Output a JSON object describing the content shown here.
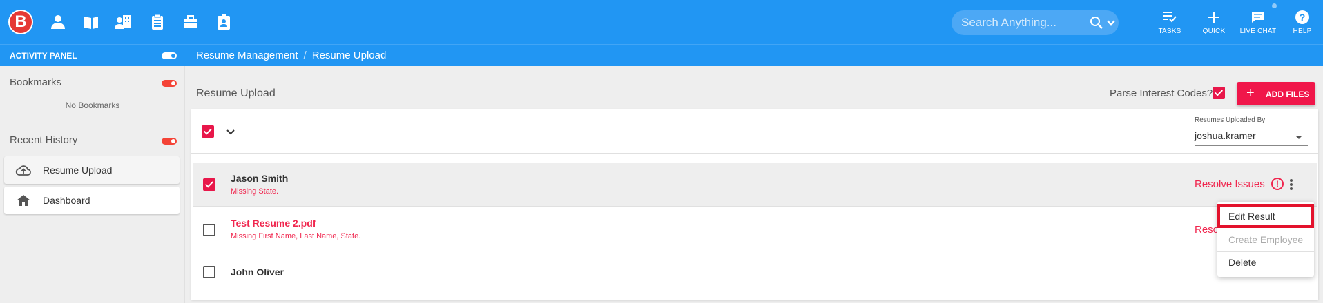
{
  "app": {
    "logo_letter": "B",
    "brand_color": "#2196f3",
    "accent_color": "#f0164a"
  },
  "nav_icons": [
    "person-icon",
    "book-icon",
    "people-group-icon",
    "clipboard-icon",
    "briefcase-icon",
    "badge-icon"
  ],
  "search": {
    "placeholder": "Search Anything..."
  },
  "top_actions": {
    "tasks": "TASKS",
    "quick": "QUICK",
    "live_chat": "LIVE CHAT",
    "help": "HELP"
  },
  "activity_panel": {
    "title": "ACTIVITY PANEL",
    "bookmarks_title": "Bookmarks",
    "no_bookmarks": "No Bookmarks",
    "recent_title": "Recent History",
    "recent_items": [
      {
        "label": "Resume Upload",
        "icon": "cloud-upload-icon"
      },
      {
        "label": "Dashboard",
        "icon": "home-icon"
      }
    ]
  },
  "breadcrumb": {
    "parent": "Resume Management",
    "separator": "/",
    "current": "Resume Upload"
  },
  "main": {
    "page_title": "Resume Upload",
    "parse_label": "Parse Interest Codes?",
    "parse_checked": true,
    "add_files_label": "ADD FILES",
    "filter_label": "Resumes Uploaded By",
    "filter_value": "joshua.kramer",
    "rows": [
      {
        "name": "Jason Smith",
        "message": "Missing State.",
        "checked": true,
        "action": "Resolve Issues"
      },
      {
        "name": "Test Resume 2.pdf",
        "message": "Missing First Name, Last Name, State.",
        "checked": false,
        "action": "Reso"
      },
      {
        "name": "John Oliver",
        "message": "",
        "checked": false,
        "action": ""
      }
    ]
  },
  "context_menu": {
    "items": [
      {
        "label": "Edit Result",
        "disabled": false,
        "highlighted": true
      },
      {
        "label": "Create Employee",
        "disabled": true,
        "highlighted": false
      },
      {
        "label": "Delete",
        "disabled": false,
        "highlighted": false
      }
    ]
  }
}
